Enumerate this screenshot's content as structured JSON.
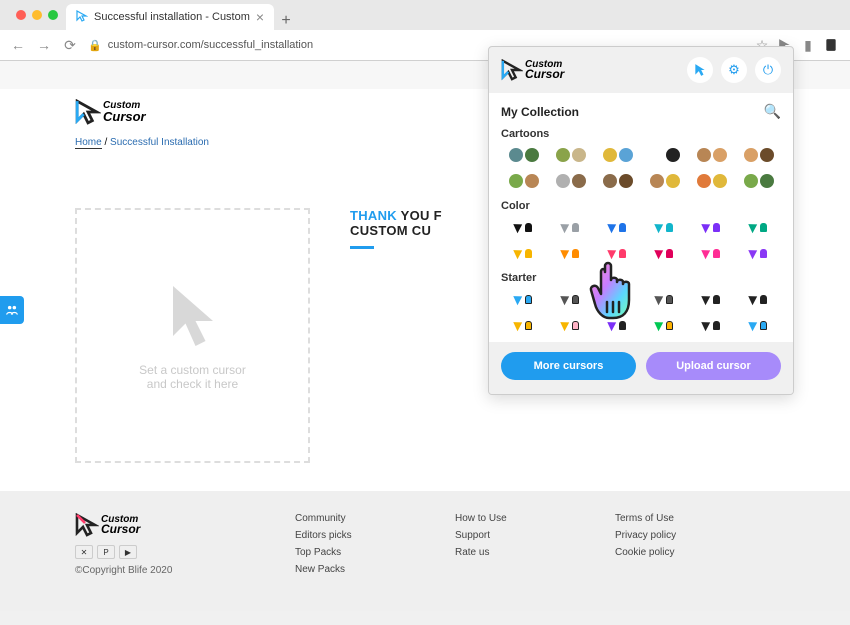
{
  "browser": {
    "tab_title": "Successful installation - Custom",
    "url": "custom-cursor.com/successful_installation"
  },
  "page": {
    "logo_top": "Custom",
    "logo_bottom": "Cursor",
    "breadcrumb_home": "Home",
    "breadcrumb_sep": " / ",
    "breadcrumb_current": "Successful Installation",
    "preview_line1": "Set a custom cursor",
    "preview_line2": "and check it here",
    "thank_accent": "THANK",
    "thank_rest_1": " YOU F",
    "thank_line2": "CUSTOM CU"
  },
  "popup": {
    "logo_top": "Custom",
    "logo_bottom": "Cursor",
    "collection_title": "My Collection",
    "sections": {
      "cartoons": "Cartoons",
      "color": "Color",
      "starter": "Starter"
    },
    "more_button": "More cursors",
    "upload_button": "Upload cursor",
    "cartoon_colors": [
      [
        "#5b8a8f",
        "#4a7a40"
      ],
      [
        "#8aa34a",
        "#c9b68a"
      ],
      [
        "#e0b83a",
        "#5aa3d6"
      ],
      [
        "#ffffff",
        "#222222"
      ],
      [
        "#b88655",
        "#d9a066"
      ],
      [
        "#d9a066",
        "#6b4b2a"
      ],
      [
        "#79a94a",
        "#b88655"
      ],
      [
        "#b0b0b0",
        "#8a6b4a"
      ],
      [
        "#8a6b4a",
        "#6b4b2a"
      ],
      [
        "#b88655",
        "#e0b83a"
      ],
      [
        "#e07a3a",
        "#e0b83a"
      ],
      [
        "#79a94a",
        "#4a7a40"
      ]
    ],
    "color_colors": [
      "#111111",
      "#9aa0a6",
      "#1e73e8",
      "#12b5cb",
      "#7b2ff7",
      "#00a884",
      "#f7b500",
      "#ff8c00",
      "#ff3b6b",
      "#e0005a",
      "#ff2d95",
      "#8a38f5"
    ],
    "starter_colors": [
      [
        "#2aa9f3",
        "#2aa9f3"
      ],
      [
        "#555",
        "#555"
      ],
      [
        "#888",
        "#888"
      ],
      [
        "#555",
        "#555"
      ],
      [
        "#222",
        "#222"
      ],
      [
        "#222",
        "#222"
      ],
      [
        "#f7b500",
        "#f7b500"
      ],
      [
        "#f7b500",
        "#ffb3c6"
      ],
      [
        "#7b2ff7",
        "#222"
      ],
      [
        "#00c853",
        "#ffb300"
      ],
      [
        "#222",
        "#222"
      ],
      [
        "#2aa9f3",
        "#2aa9f3"
      ]
    ]
  },
  "footer": {
    "copyright": "©Copyright Blife 2020",
    "col2": [
      "Community",
      "Editors picks",
      "Top Packs",
      "New Packs"
    ],
    "col3": [
      "How to Use",
      "Support",
      "Rate us"
    ],
    "col4": [
      "Terms of Use",
      "Privacy policy",
      "Cookie policy"
    ]
  }
}
